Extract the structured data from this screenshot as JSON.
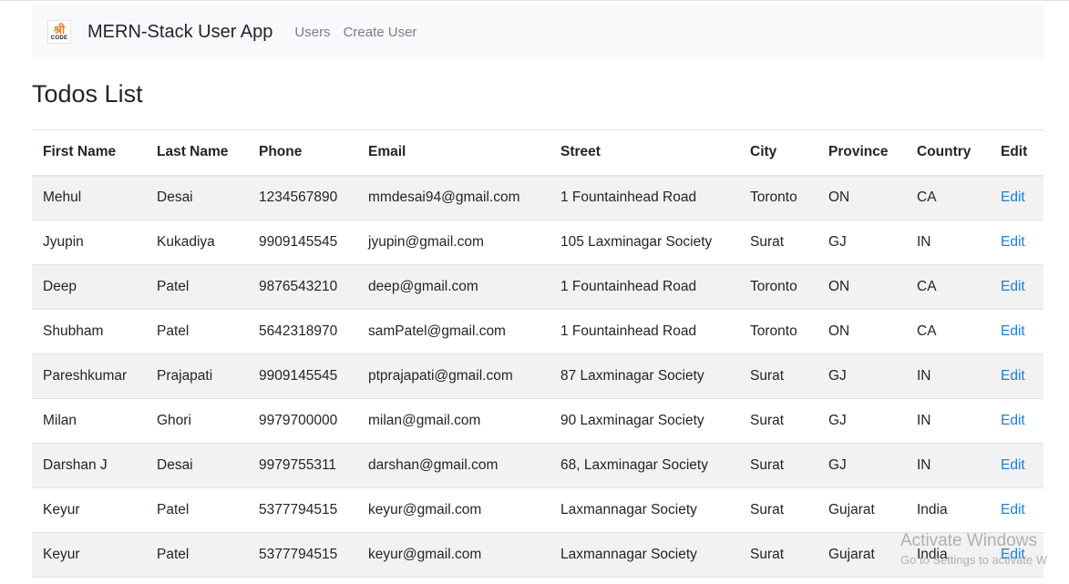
{
  "navbar": {
    "logo_glyph": "श्री",
    "logo_code": "CODE",
    "brand": "MERN-Stack User App",
    "links": [
      "Users",
      "Create User"
    ]
  },
  "page": {
    "title": "Todos List"
  },
  "table": {
    "headers": [
      "First Name",
      "Last Name",
      "Phone",
      "Email",
      "Street",
      "City",
      "Province",
      "Country",
      "Edit"
    ],
    "rows": [
      {
        "first": "Mehul",
        "last": "Desai",
        "phone": "1234567890",
        "email": "mmdesai94@gmail.com",
        "street": "1 Fountainhead Road",
        "city": "Toronto",
        "province": "ON",
        "country": "CA",
        "edit": "Edit"
      },
      {
        "first": "Jyupin",
        "last": "Kukadiya",
        "phone": "9909145545",
        "email": "jyupin@gmail.com",
        "street": "105 Laxminagar Society",
        "city": "Surat",
        "province": "GJ",
        "country": "IN",
        "edit": "Edit"
      },
      {
        "first": "Deep",
        "last": "Patel",
        "phone": "9876543210",
        "email": "deep@gmail.com",
        "street": "1 Fountainhead Road",
        "city": "Toronto",
        "province": "ON",
        "country": "CA",
        "edit": "Edit"
      },
      {
        "first": "Shubham",
        "last": "Patel",
        "phone": "5642318970",
        "email": "samPatel@gmail.com",
        "street": "1 Fountainhead Road",
        "city": "Toronto",
        "province": "ON",
        "country": "CA",
        "edit": "Edit"
      },
      {
        "first": "Pareshkumar",
        "last": "Prajapati",
        "phone": "9909145545",
        "email": "ptprajapati@gmail.com",
        "street": "87 Laxminagar Society",
        "city": "Surat",
        "province": "GJ",
        "country": "IN",
        "edit": "Edit"
      },
      {
        "first": "Milan",
        "last": "Ghori",
        "phone": "9979700000",
        "email": "milan@gmail.com",
        "street": "90 Laxminagar Society",
        "city": "Surat",
        "province": "GJ",
        "country": "IN",
        "edit": "Edit"
      },
      {
        "first": "Darshan J",
        "last": "Desai",
        "phone": "9979755311",
        "email": "darshan@gmail.com",
        "street": "68, Laxminagar Society",
        "city": "Surat",
        "province": "GJ",
        "country": "IN",
        "edit": "Edit"
      },
      {
        "first": "Keyur",
        "last": "Patel",
        "phone": "5377794515",
        "email": "keyur@gmail.com",
        "street": "Laxmannagar Society",
        "city": "Surat",
        "province": "Gujarat",
        "country": "India",
        "edit": "Edit"
      },
      {
        "first": "Keyur",
        "last": "Patel",
        "phone": "5377794515",
        "email": "keyur@gmail.com",
        "street": "Laxmannagar Society",
        "city": "Surat",
        "province": "Gujarat",
        "country": "India",
        "edit": "Edit"
      }
    ]
  },
  "watermark": {
    "title": "Activate Windows",
    "subtitle": "Go to Settings to activate W"
  },
  "colors": {
    "link": "#1b7fd3",
    "navbar_bg": "#f8f9fa",
    "stripe": "#f2f2f2"
  }
}
